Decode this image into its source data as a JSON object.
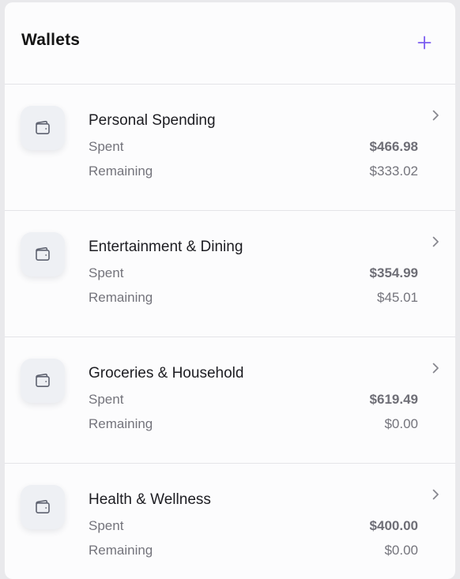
{
  "header": {
    "title": "Wallets"
  },
  "colors": {
    "accent": "#7b5cf0",
    "muted_text": "#74747c",
    "icon_bg": "#eef0f4"
  },
  "icons": {
    "add": "plus-icon",
    "wallet": "wallet-icon",
    "chevron": "chevron-right-icon"
  },
  "wallets": [
    {
      "name": "Personal Spending",
      "spent_label": "Spent",
      "spent": "$466.98",
      "remaining_label": "Remaining",
      "remaining": "$333.02"
    },
    {
      "name": "Entertainment & Dining",
      "spent_label": "Spent",
      "spent": "$354.99",
      "remaining_label": "Remaining",
      "remaining": "$45.01"
    },
    {
      "name": "Groceries & Household",
      "spent_label": "Spent",
      "spent": "$619.49",
      "remaining_label": "Remaining",
      "remaining": "$0.00"
    },
    {
      "name": "Health & Wellness",
      "spent_label": "Spent",
      "spent": "$400.00",
      "remaining_label": "Remaining",
      "remaining": "$0.00"
    }
  ]
}
